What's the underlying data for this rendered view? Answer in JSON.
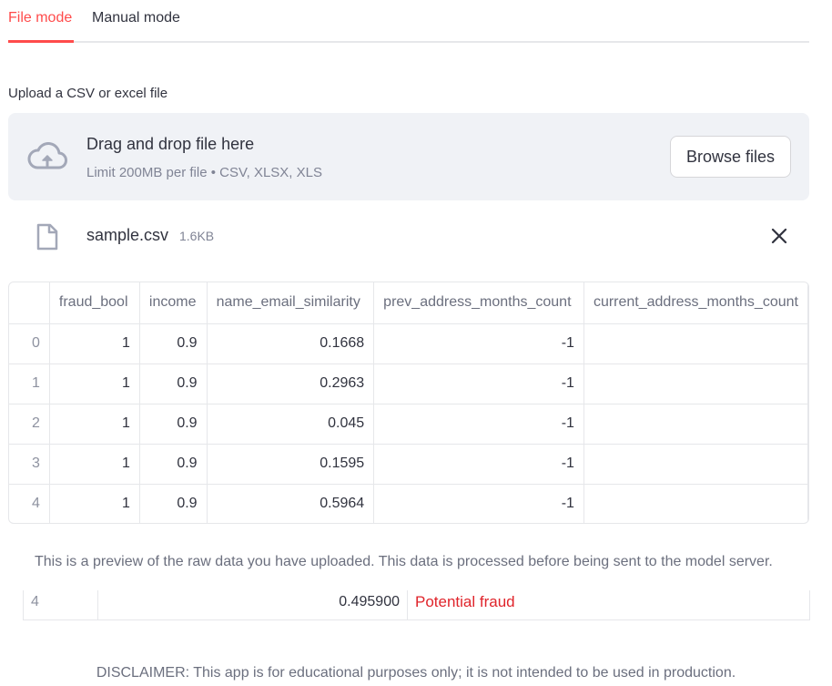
{
  "tabs": [
    {
      "label": "File mode",
      "active": true
    },
    {
      "label": "Manual mode",
      "active": false
    }
  ],
  "uploader": {
    "label": "Upload a CSV or excel file",
    "drop_title": "Drag and drop file here",
    "limit_text": "Limit 200MB per file • CSV, XLSX, XLS",
    "browse_label": "Browse files",
    "icon": "cloud-upload-icon"
  },
  "uploaded_file": {
    "name": "sample.csv",
    "size": "1.6KB",
    "icon": "file-icon",
    "remove_icon": "close-icon"
  },
  "dataframe": {
    "columns": [
      "",
      "fraud_bool",
      "income",
      "name_email_similarity",
      "prev_address_months_count",
      "current_address_months_count"
    ],
    "rows": [
      [
        "0",
        "1",
        "0.9",
        "0.1668",
        "-1",
        ""
      ],
      [
        "1",
        "1",
        "0.9",
        "0.2963",
        "-1",
        ""
      ],
      [
        "2",
        "1",
        "0.9",
        "0.045",
        "-1",
        ""
      ],
      [
        "3",
        "1",
        "0.9",
        "0.1595",
        "-1",
        ""
      ],
      [
        "4",
        "1",
        "0.9",
        "0.5964",
        "-1",
        ""
      ]
    ]
  },
  "preview_note": "This is a preview of the raw data you have uploaded. This data is processed before being sent to the model server.",
  "result_row": {
    "index": "4",
    "score": "0.495900",
    "label": "Potential fraud"
  },
  "disclaimer": "DISCLAIMER: This app is for educational purposes only; it is not intended to be used in production.",
  "colors": {
    "accent": "#ff4b4b",
    "fraud": "#e0242b",
    "dropzone_bg": "#f0f2f6"
  }
}
